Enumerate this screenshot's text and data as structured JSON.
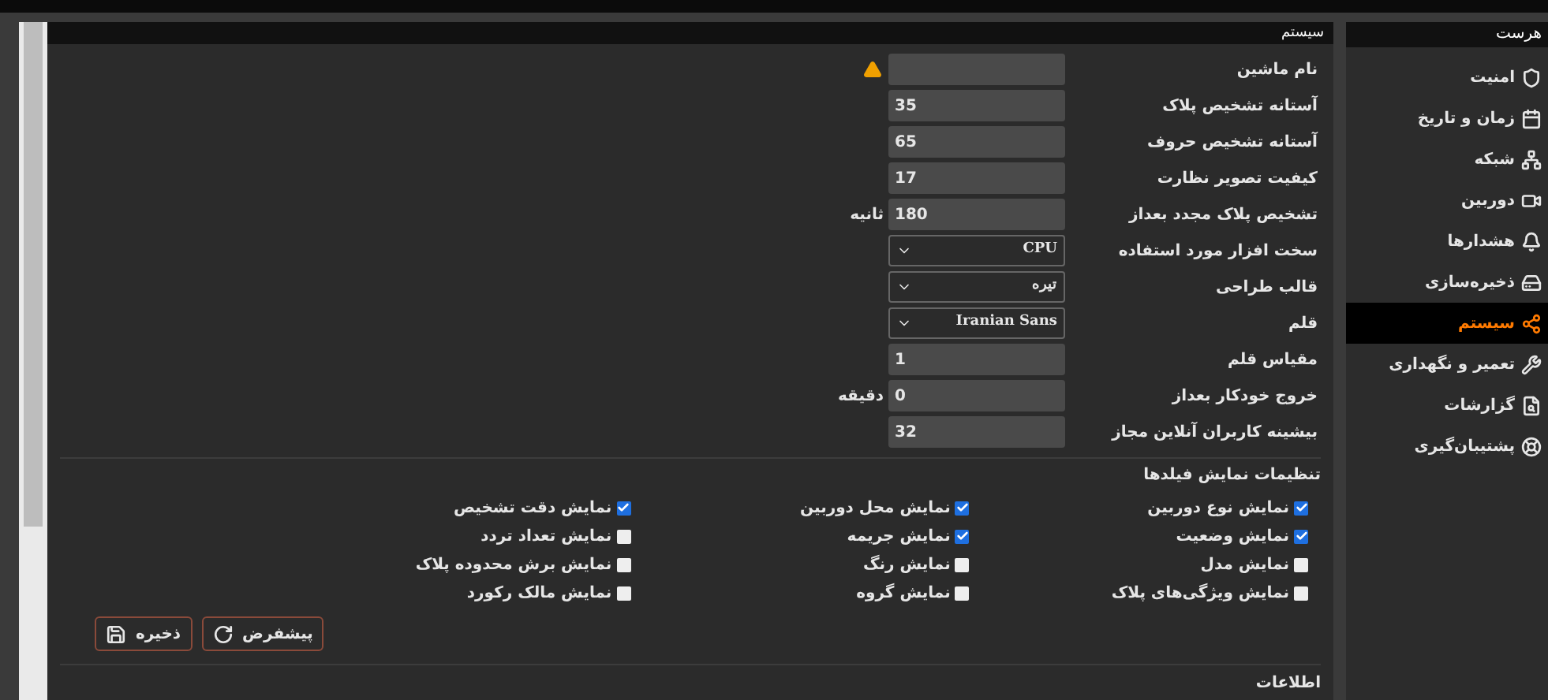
{
  "sidebar": {
    "title": "هرست",
    "items": [
      {
        "label": "امنیت",
        "selected": false
      },
      {
        "label": "زمان و تاریخ",
        "selected": false
      },
      {
        "label": "شبکه",
        "selected": false
      },
      {
        "label": "دوربین",
        "selected": false
      },
      {
        "label": "هشدارها",
        "selected": false
      },
      {
        "label": "ذخیره‌سازی",
        "selected": false
      },
      {
        "label": "سیستم",
        "selected": true
      },
      {
        "label": "تعمیر و نگهداری",
        "selected": false
      },
      {
        "label": "گزارشات",
        "selected": false
      },
      {
        "label": "پشتیبان‌گیری",
        "selected": false
      }
    ]
  },
  "panel": {
    "title": "سیستم",
    "fields": [
      {
        "label": "نام ماشین",
        "kind": "text",
        "warning": true
      },
      {
        "label": "آستانه تشخیص پلاک",
        "kind": "text",
        "value": "35"
      },
      {
        "label": "آستانه تشخیص حروف",
        "kind": "text",
        "value": "65"
      },
      {
        "label": "کیفیت تصویر نظارت",
        "kind": "text",
        "value": "17"
      },
      {
        "label": "تشخیص پلاک مجدد بعداز",
        "kind": "text",
        "value": "180",
        "unit": "ثانیه"
      },
      {
        "label": "سخت افزار مورد استفاده",
        "kind": "select",
        "value": "CPU"
      },
      {
        "label": "قالب طراحی",
        "kind": "select",
        "value": "تیره"
      },
      {
        "label": "قلم",
        "kind": "select",
        "value": "Iranian Sans"
      },
      {
        "label": "مقیاس قلم",
        "kind": "text",
        "value": "1"
      },
      {
        "label": "خروج خودکار بعداز",
        "kind": "text",
        "value": "0",
        "unit": "دقیقه"
      },
      {
        "label": "بیشینه کاربران آنلاین مجاز",
        "kind": "text",
        "value": "32"
      }
    ],
    "display_section": "تنظیمات نمایش فیلدها",
    "checkboxes": [
      {
        "label": "نمایش نوع دوربین",
        "checked": true
      },
      {
        "label": "نمایش محل دوربین",
        "checked": true
      },
      {
        "label": "نمایش دقت تشخیص",
        "checked": true
      },
      {
        "label": "نمایش وضعیت",
        "checked": true
      },
      {
        "label": "نمایش جریمه",
        "checked": true
      },
      {
        "label": "نمایش تعداد تردد",
        "checked": false
      },
      {
        "label": "نمایش مدل",
        "checked": false
      },
      {
        "label": "نمایش رنگ",
        "checked": false
      },
      {
        "label": "نمایش برش محدوده پلاک",
        "checked": false
      },
      {
        "label": "نمایش ویژگی‌های پلاک",
        "checked": false
      },
      {
        "label": "نمایش گروه",
        "checked": false
      },
      {
        "label": "نمایش مالک رکورد",
        "checked": false
      }
    ],
    "buttons": [
      {
        "label": "پیشفرض"
      },
      {
        "label": "ذخیره"
      }
    ],
    "info_section": "اطلاعات"
  }
}
